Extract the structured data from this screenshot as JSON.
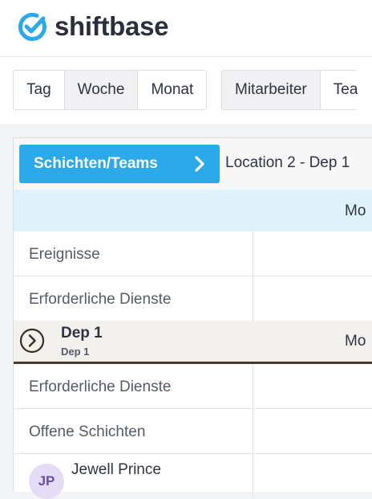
{
  "brand": {
    "name": "shiftbase",
    "accent": "#2ba9e8"
  },
  "view_toggle": {
    "items": [
      "Tag",
      "Woche",
      "Monat"
    ],
    "active": "Woche"
  },
  "group_toggle": {
    "items": [
      "Mitarbeiter",
      "Tea"
    ],
    "active": "Mitarbeiter"
  },
  "schedule": {
    "teams_button": "Schichten/Teams",
    "location": "Location 2 - Dep 1",
    "day_header": "Mo",
    "rows": {
      "events": "Ereignisse",
      "required": "Erforderliche Dienste"
    },
    "department": {
      "title": "Dep 1",
      "subtitle": "Dep 1",
      "day": "Mo",
      "rows": {
        "required": "Erforderliche Dienste",
        "open": "Offene Schichten"
      },
      "employee": {
        "initials": "JP",
        "name": "Jewell Prince"
      }
    }
  },
  "icons": [
    "check-circle-logo-icon",
    "chevron-right-icon",
    "circle-chevron-right-icon"
  ]
}
